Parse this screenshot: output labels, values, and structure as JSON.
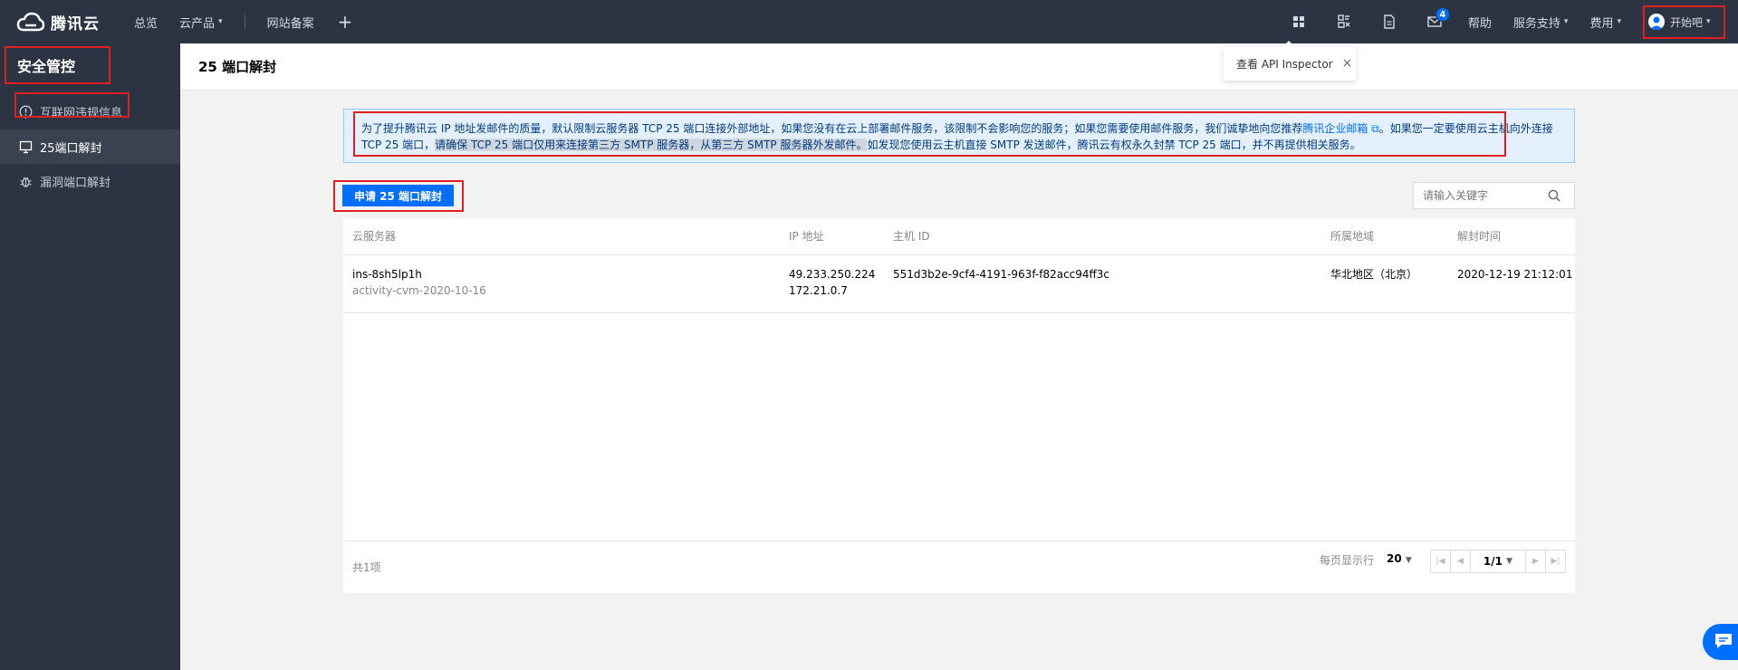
{
  "topbar": {
    "brand": "腾讯云",
    "nav": {
      "overview": "总览",
      "products": "云产品",
      "icp": "网站备案",
      "add": "+"
    },
    "message_count": "4",
    "help": "帮助",
    "support": "服务支持",
    "billing": "费用",
    "user": "开始吧"
  },
  "tooltip": {
    "text": "查看 API Inspector",
    "close": "×"
  },
  "sidebar": {
    "title": "安全管控",
    "items": [
      {
        "label": "互联网违规信息",
        "icon": "info-circle-icon"
      },
      {
        "label": "25端口解封",
        "icon": "monitor-icon",
        "active": true
      },
      {
        "label": "漏洞端口解封",
        "icon": "bug-icon"
      }
    ]
  },
  "page": {
    "title": "25 端口解封"
  },
  "notice": {
    "part1": "为了提升腾讯云 IP 地址发邮件的质量，默认限制云服务器 TCP 25 端口连接外部地址，如果您没有在云上部署邮件服务，该限制不会影响您的服务；如果您需要使用邮件服务，我们诚挚地向您推荐",
    "link": "腾讯企业邮箱",
    "part2": "。如果您一定要使用云主机向外连接 TCP 25 端口，",
    "highlight": "请确保 TCP 25 端口仅用来连接第三方 SMTP 服务器，从第三方 SMTP 服务器外发邮件。",
    "part3": "如发现您使用云主机直接 SMTP 发送邮件，腾讯云有权永久封禁 TCP 25 端口，并不再提供相关服务。"
  },
  "apply_button": "申请 25 端口解封",
  "search": {
    "placeholder": "请输入关键字"
  },
  "table": {
    "columns": [
      "云服务器",
      "IP 地址",
      "主机 ID",
      "所属地域",
      "解封时间"
    ],
    "rows": [
      {
        "instance_id": "ins-8sh5lp1h",
        "instance_name": "activity-cvm-2020-10-16",
        "public_ip": "49.233.250.224",
        "private_ip": "172.21.0.7",
        "host_id": "551d3b2e-9cf4-4191-963f-f82acc94ff3c",
        "region": "华北地区（北京）",
        "unblock_time": "2020-12-19 21:12:01"
      }
    ]
  },
  "footer": {
    "total": "共1项",
    "per_page_label": "每页显示行",
    "per_page": "20",
    "page": "1/1"
  },
  "colors": {
    "topbar": "#2c3444",
    "accent": "#006eff",
    "annotation": "#e02020",
    "notice_bg": "#e5f0ff"
  }
}
